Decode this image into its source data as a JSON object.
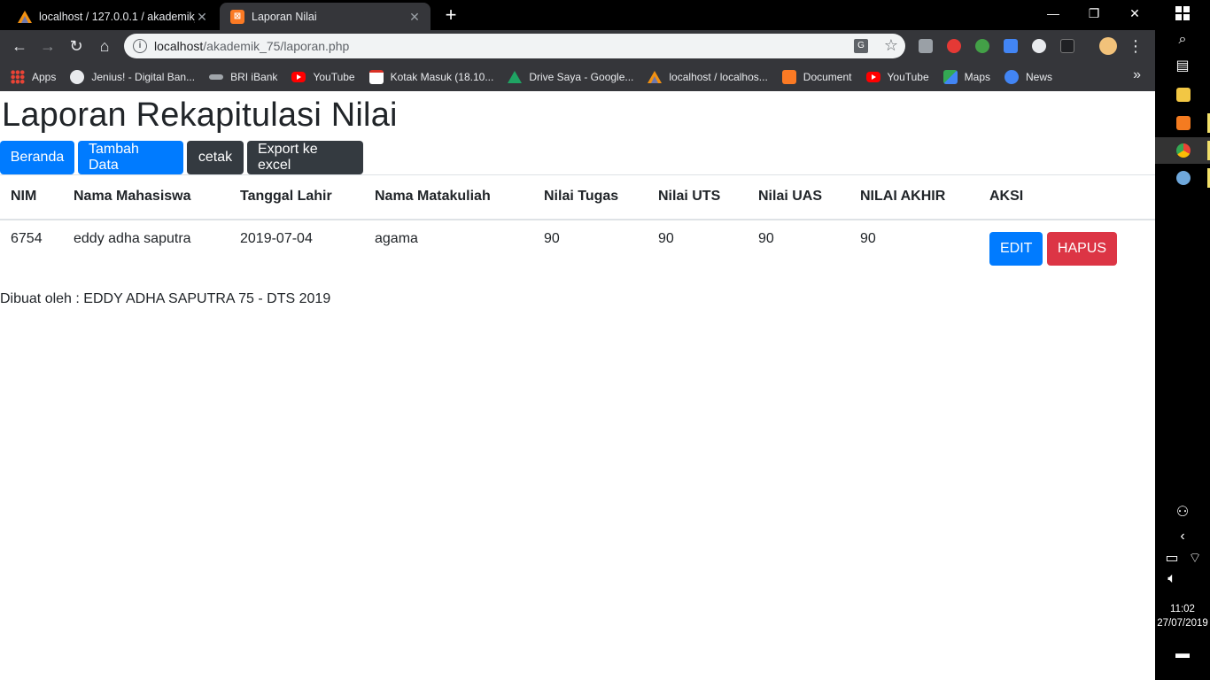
{
  "browser": {
    "tabs": [
      {
        "title": "localhost / 127.0.0.1 / akademik_",
        "icon": "phpmyadmin-icon",
        "active": false
      },
      {
        "title": "Laporan Nilai",
        "icon": "xampp-icon",
        "active": true
      }
    ],
    "address": {
      "host": "localhost",
      "path": "/akademik_75/laporan.php"
    },
    "bookmarks": [
      {
        "label": "Apps",
        "icon": "apps-icon"
      },
      {
        "label": "Jenius! - Digital Ban...",
        "icon": "globe-icon"
      },
      {
        "label": "BRI iBank",
        "icon": "bri-icon"
      },
      {
        "label": "YouTube",
        "icon": "youtube-icon"
      },
      {
        "label": "Kotak Masuk (18.10...",
        "icon": "gmail-icon"
      },
      {
        "label": "Drive Saya - Google...",
        "icon": "drive-icon"
      },
      {
        "label": "localhost / localhos...",
        "icon": "phpmyadmin-icon"
      },
      {
        "label": "Document",
        "icon": "xampp-icon"
      },
      {
        "label": "YouTube",
        "icon": "youtube-icon"
      },
      {
        "label": "Maps",
        "icon": "maps-icon"
      },
      {
        "label": "News",
        "icon": "news-icon"
      }
    ],
    "more_bookmarks": "»"
  },
  "page": {
    "title": "Laporan Rekapitulasi Nilai",
    "buttons": {
      "home": "Beranda",
      "add": "Tambah Data",
      "print": "cetak",
      "export": "Export ke excel"
    },
    "table": {
      "headers": [
        "NIM",
        "Nama Mahasiswa",
        "Tanggal Lahir",
        "Nama Matakuliah",
        "Nilai Tugas",
        "Nilai UTS",
        "Nilai UAS",
        "NILAI AKHIR",
        "AKSI"
      ],
      "rows": [
        {
          "nim": "6754",
          "nama": "eddy adha saputra",
          "tgl_lahir": "2019-07-04",
          "matakuliah": "agama",
          "tugas": "90",
          "uts": "90",
          "uas": "90",
          "akhir": "90",
          "edit": "EDIT",
          "delete": "HAPUS"
        }
      ]
    },
    "footer": "Dibuat oleh : EDDY ADHA SAPUTRA 75 - DTS 2019"
  },
  "taskbar": {
    "time": "11:02",
    "date": "27/07/2019"
  },
  "colors": {
    "primary": "#007bff",
    "dark": "#343a40",
    "danger": "#dc3545"
  }
}
